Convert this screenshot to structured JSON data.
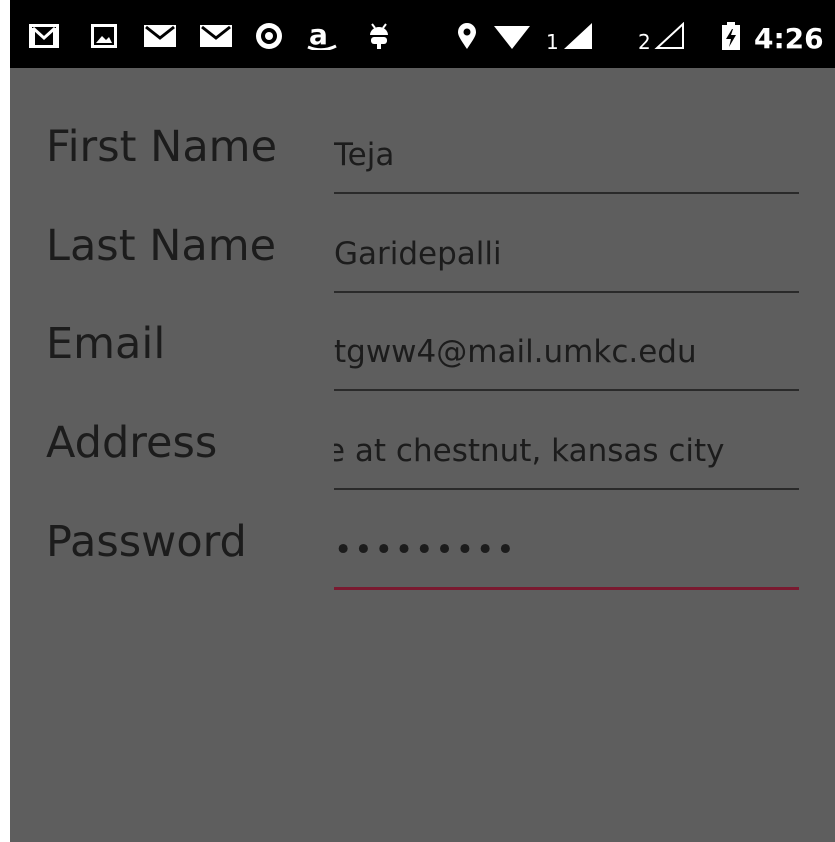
{
  "status_bar": {
    "icons": [
      "gmail-icon",
      "gallery-icon",
      "mail-icon",
      "mail-icon",
      "opera-icon",
      "amazon-icon",
      "android-icon",
      "location-icon",
      "wifi-icon",
      "signal-icon",
      "signal-empty-icon",
      "battery-charging-icon"
    ],
    "sim1_label": "1",
    "sim2_label": "2",
    "time": "4:26"
  },
  "form": {
    "first_name": {
      "label": "First Name",
      "value": "Teja"
    },
    "last_name": {
      "label": "Last Name",
      "value": "Garidepalli"
    },
    "email": {
      "label": "Email",
      "value": "tgww4@mail.umkc.edu"
    },
    "address": {
      "label": "Address",
      "value": "e at chestnut, kansas city"
    },
    "password": {
      "label": "Password",
      "value": "•••••••••"
    }
  },
  "colors": {
    "background": "#5e5e5e",
    "status_bar": "#000000",
    "text": "#1c1c1c",
    "active_underline": "#7a1a30"
  }
}
